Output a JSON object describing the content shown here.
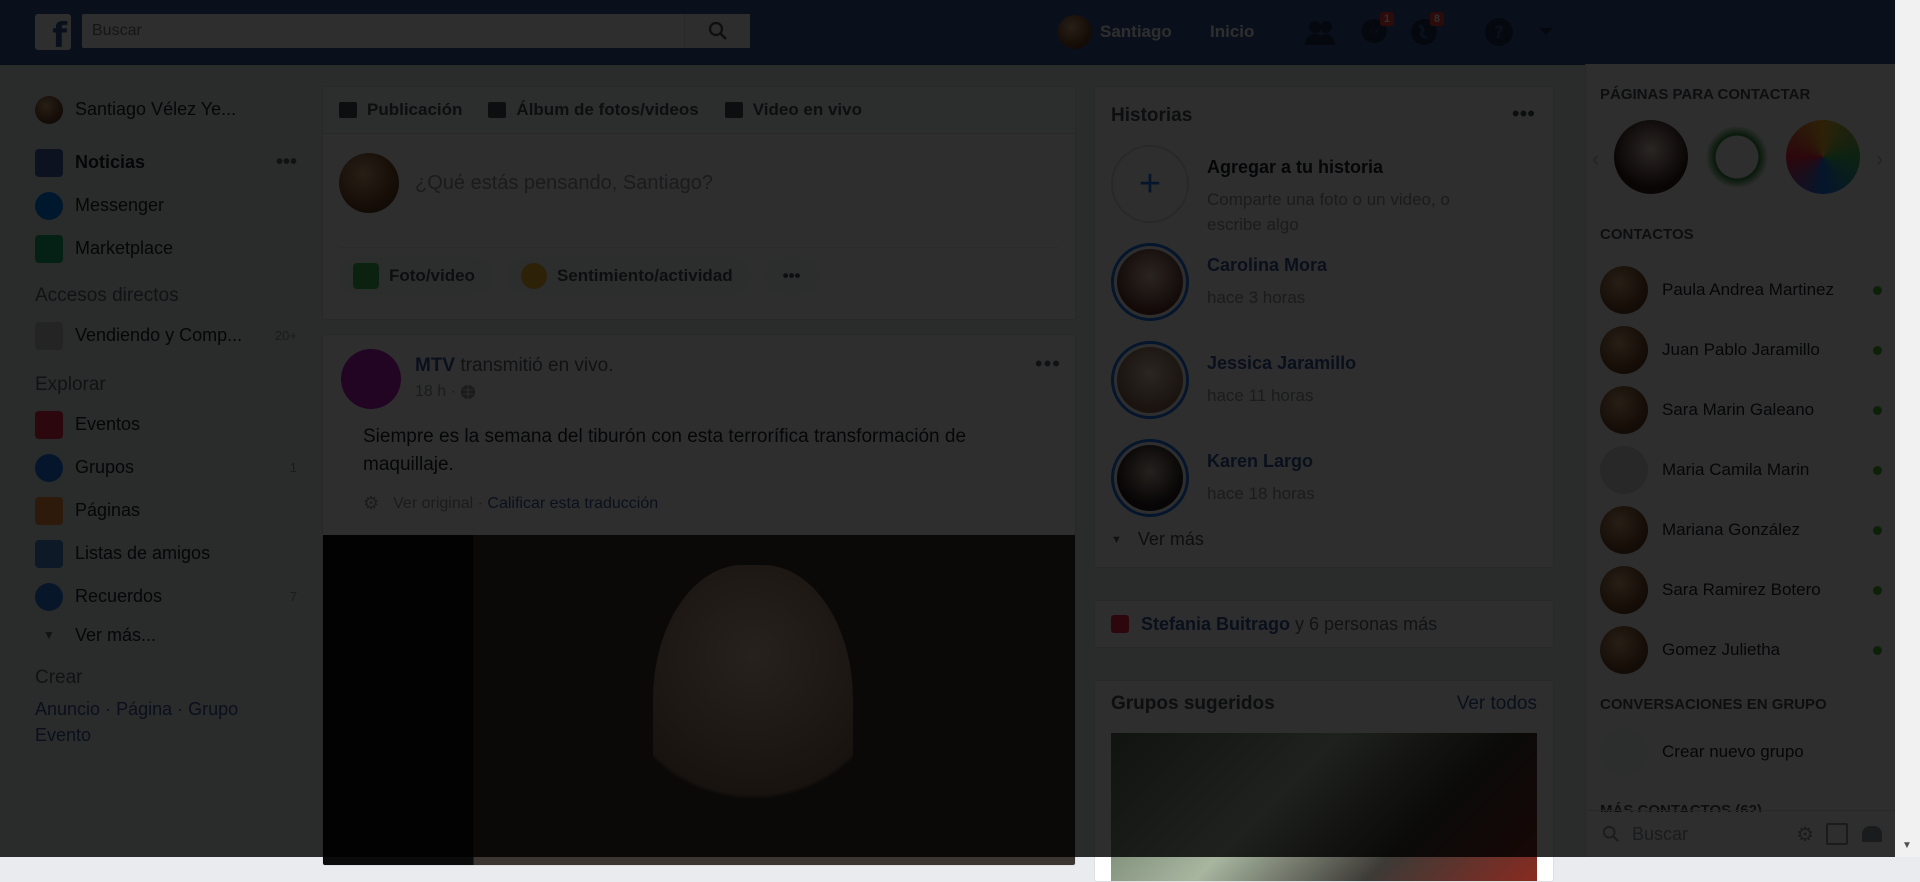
{
  "topbar": {
    "logo": "f",
    "search_placeholder": "Buscar",
    "profile_name": "Santiago",
    "home_label": "Inicio",
    "messages_badge": "1",
    "notifications_badge": "8"
  },
  "left_nav": {
    "profile_name": "Santiago Vélez Ye...",
    "items": [
      {
        "label": "Noticias"
      },
      {
        "label": "Messenger"
      },
      {
        "label": "Marketplace"
      }
    ],
    "shortcuts_title": "Accesos directos",
    "shortcut": {
      "label": "Vendiendo y Comp...",
      "count": "20+"
    },
    "explore_title": "Explorar",
    "explore_items": [
      {
        "label": "Eventos",
        "count": ""
      },
      {
        "label": "Grupos",
        "count": "1"
      },
      {
        "label": "Páginas",
        "count": ""
      },
      {
        "label": "Listas de amigos",
        "count": ""
      },
      {
        "label": "Recuerdos",
        "count": "7"
      }
    ],
    "see_more": "Ver más...",
    "create_title": "Crear",
    "create_links": [
      "Anuncio",
      "Página",
      "Grupo",
      "Evento"
    ]
  },
  "composer": {
    "tabs": [
      "Publicación",
      "Álbum de fotos/videos",
      "Video en vivo"
    ],
    "placeholder": "¿Qué estás pensando, Santiago?",
    "actions": [
      "Foto/video",
      "Sentimiento/actividad"
    ],
    "more": "•••"
  },
  "post": {
    "author": "MTV",
    "action": " transmitió en vivo.",
    "time": "18 h · ",
    "more": "•••",
    "text": "Siempre es la semana del tiburón con esta terrorífica transformación de maquillaje.",
    "view_original": "Ver original",
    "rate_translation": "Calificar esta traducción",
    "separator": " · "
  },
  "stories": {
    "title": "Historias",
    "more": "•••",
    "add": {
      "title": "Agregar a tu historia",
      "subtitle": "Comparte una foto o un video, o escribe algo"
    },
    "items": [
      {
        "name": "Carolina Mora",
        "time": "hace 3 horas"
      },
      {
        "name": "Jessica Jaramillo",
        "time": "hace 11 horas"
      },
      {
        "name": "Karen Largo",
        "time": "hace 18 horas"
      }
    ],
    "view_more": "Ver más"
  },
  "birthdays": {
    "name": "Stefania Buitrago",
    "rest": " y 6 personas más"
  },
  "groups": {
    "title": "Grupos sugeridos",
    "see_all": "Ver todos"
  },
  "right_col": {
    "pages_title": "PÁGINAS PARA CONTACTAR",
    "contacts_title": "CONTACTOS",
    "contacts": [
      "Paula Andrea Martinez",
      "Juan Pablo Jaramillo",
      "Sara Marin Galeano",
      "Maria Camila Marin",
      "Mariana González",
      "Sara Ramirez Botero",
      "Gomez Julietha"
    ],
    "group_conv_title": "CONVERSACIONES EN GRUPO",
    "create_group": "Crear nuevo grupo",
    "more_contacts": "MÁS CONTACTOS (62)",
    "search_placeholder": "Buscar"
  }
}
